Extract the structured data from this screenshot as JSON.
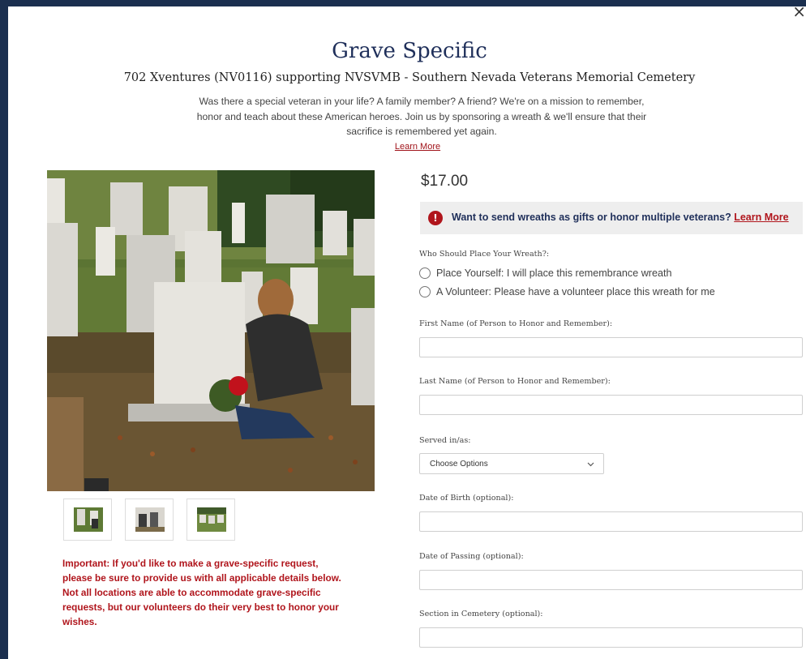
{
  "modal": {
    "close_label": "×",
    "title": "Grave Specific",
    "subtitle": "702 Xventures (NV0116) supporting NVSVMB - Southern Nevada Veterans Memorial Cemetery",
    "intro_line1": "Was there a special veteran in your life? A family member? A friend? We're on a mission to remember,",
    "intro_line2": "honor and teach about these American heroes. Join us by sponsoring a wreath & we'll ensure that their",
    "intro_line3": "sacrifice is remembered yet again.",
    "learn_more": "Learn More"
  },
  "gallery": {
    "thumbnail_count": 3
  },
  "important_note": {
    "line1": "Important: If you'd like to make a grave-specific request,",
    "line2": "please be sure to provide us with all applicable details below.",
    "line3": "Not all locations are able to accommodate grave-specific",
    "line4": "requests, but our volunteers do their very best to honor your",
    "line5": "wishes."
  },
  "product": {
    "price": "$17.00",
    "banner_icon": "!",
    "banner_text": "Want to send wreaths as gifts or honor multiple veterans?",
    "banner_link": "Learn More"
  },
  "form": {
    "placement_label": "Who Should Place Your Wreath?:",
    "placement_options": [
      {
        "label": "Place Yourself: I will place this remembrance wreath",
        "selected": false
      },
      {
        "label": "A Volunteer: Please have a volunteer place this wreath for me",
        "selected": false
      }
    ],
    "first_name_label": "First Name (of Person to Honor and Remember):",
    "first_name_value": "",
    "last_name_label": "Last Name (of Person to Honor and Remember):",
    "last_name_value": "",
    "served_label": "Served in/as:",
    "served_selected": "Choose Options",
    "dob_label": "Date of Birth (optional):",
    "dob_value": "",
    "dop_label": "Date of Passing (optional):",
    "dop_value": "",
    "section_label": "Section in Cemetery (optional):",
    "section_value": ""
  },
  "colors": {
    "backdrop": "#1b2f4f",
    "title": "#1f2f5a",
    "accent_red": "#b0151c",
    "banner_bg": "#eeeeee"
  }
}
